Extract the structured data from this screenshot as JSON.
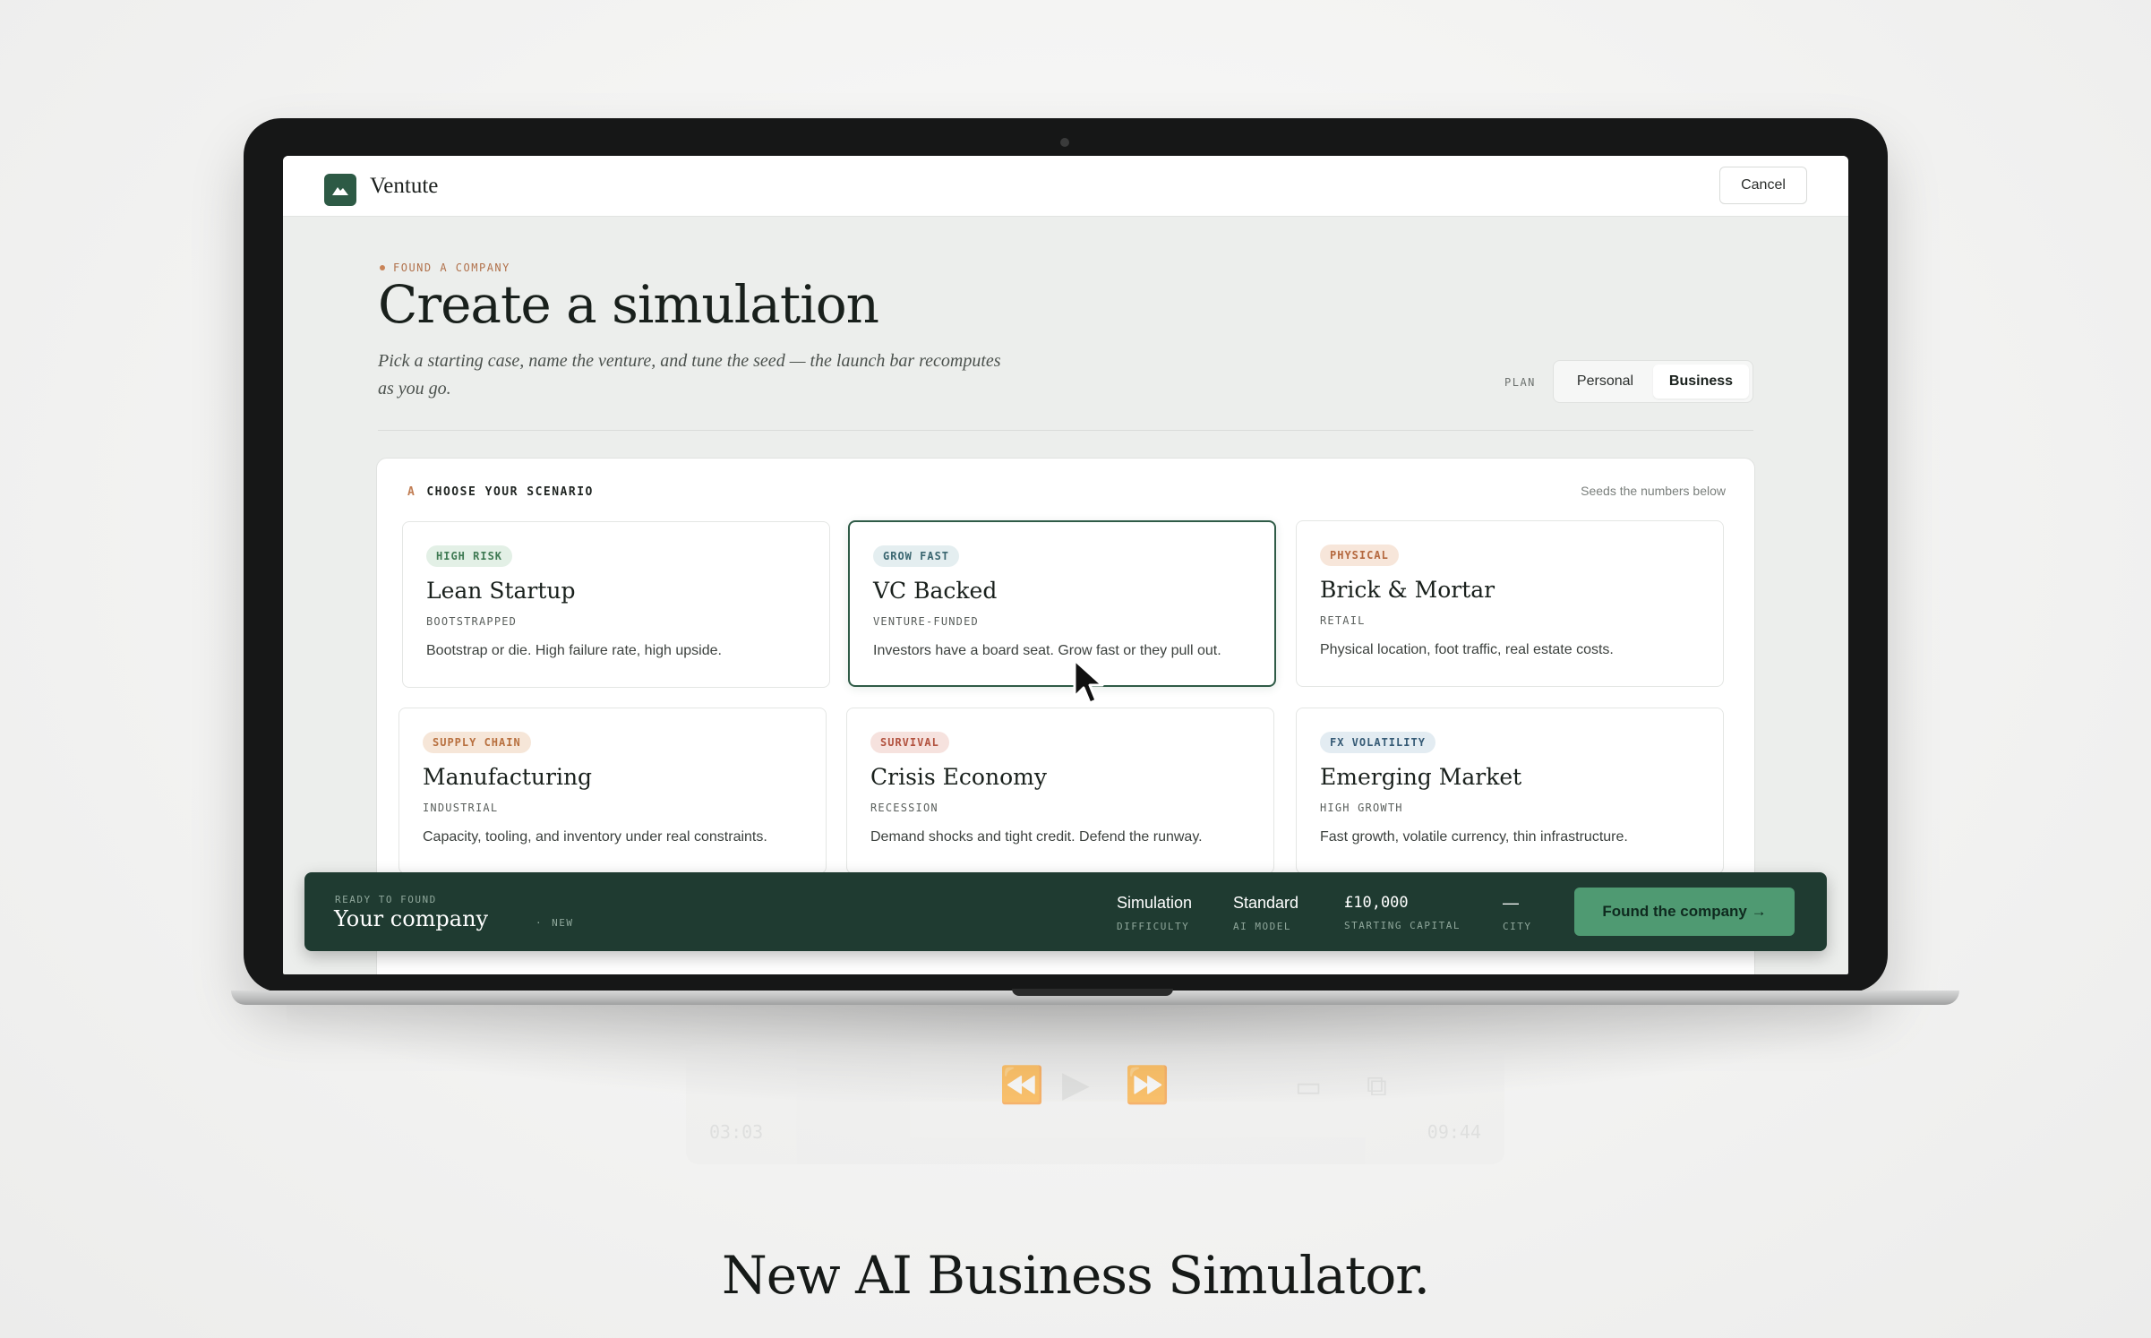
{
  "app": {
    "name": "Ventute",
    "cancel_label": "Cancel"
  },
  "page": {
    "eyebrow": "FOUND A COMPANY",
    "title": "Create a simulation",
    "subtitle": "Pick a starting case, name the venture, and tune the seed — the launch bar recomputes as you go."
  },
  "plan": {
    "label": "PLAN",
    "options": [
      "Personal",
      "Business"
    ],
    "selected": "Business"
  },
  "scenarios": {
    "section_letter": "A",
    "heading": "CHOOSE YOUR SCENARIO",
    "note": "Seeds the numbers below",
    "selected": "VC Backed",
    "cards": [
      {
        "badge": "HIGH RISK",
        "title": "Lean Startup",
        "subtitle": "BOOTSTRAPPED",
        "description": "Bootstrap or die. High failure rate, high upside.",
        "badge_bg": "#e3f0e6",
        "badge_fg": "#3f7a53"
      },
      {
        "badge": "GROW FAST",
        "title": "VC Backed",
        "subtitle": "VENTURE-FUNDED",
        "description": "Investors have a board seat. Grow fast or they pull out.",
        "badge_bg": "#e4eef0",
        "badge_fg": "#3a6670"
      },
      {
        "badge": "PHYSICAL",
        "title": "Brick & Mortar",
        "subtitle": "RETAIL",
        "description": "Physical location, foot traffic, real estate costs.",
        "badge_bg": "#f7e6da",
        "badge_fg": "#b4683e"
      },
      {
        "badge": "SUPPLY CHAIN",
        "title": "Manufacturing",
        "subtitle": "INDUSTRIAL",
        "description": "Capacity, tooling, and inventory under real constraints.",
        "badge_bg": "#f6e6d8",
        "badge_fg": "#b8703f"
      },
      {
        "badge": "SURVIVAL",
        "title": "Crisis Economy",
        "subtitle": "RECESSION",
        "description": "Demand shocks and tight credit. Defend the runway.",
        "badge_bg": "#f6e2de",
        "badge_fg": "#b2523f"
      },
      {
        "badge": "FX VOLATILITY",
        "title": "Emerging Market",
        "subtitle": "HIGH GROWTH",
        "description": "Fast growth, volatile currency, thin infrastructure.",
        "badge_bg": "#e3ecf2",
        "badge_fg": "#355a75"
      }
    ]
  },
  "launch_bar": {
    "ready_label": "READY TO FOUND",
    "company_name": "Your company",
    "separator": "·",
    "status": "NEW",
    "stats": [
      {
        "value": "Simulation",
        "label": "DIFFICULTY"
      },
      {
        "value": "Standard",
        "label": "AI MODEL"
      },
      {
        "value": "£10,000",
        "label": "STARTING CAPITAL"
      },
      {
        "value": "—",
        "label": "CITY"
      }
    ],
    "cta_label": "Found the company →"
  },
  "video_controls": {
    "elapsed": "03:03",
    "total": "09:44"
  },
  "headline": "New AI Business Simulator.",
  "colors": {
    "brand_green": "#2d5a45",
    "launch_bar_bg": "#1f3b31",
    "cta_green": "#4f9a72",
    "accent_copper": "#c07c52"
  }
}
